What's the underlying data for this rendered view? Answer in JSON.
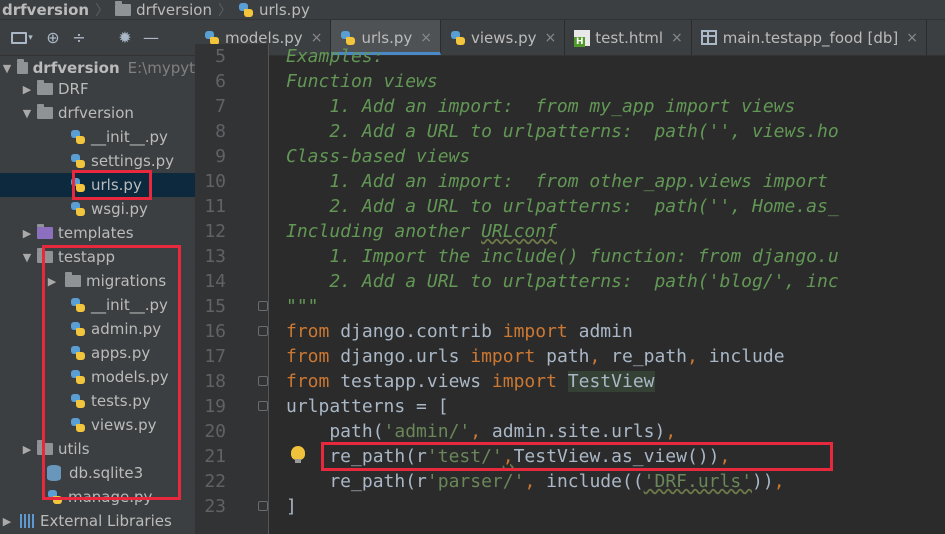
{
  "breadcrumb": [
    "drfversion",
    "drfversion",
    "urls.py"
  ],
  "tabs": [
    {
      "label": "models.py",
      "icon": "python-file-icon"
    },
    {
      "label": "urls.py",
      "icon": "python-file-icon",
      "active": true
    },
    {
      "label": "views.py",
      "icon": "python-file-icon"
    },
    {
      "label": "test.html",
      "icon": "html-file-icon"
    },
    {
      "label": "main.testapp_food [db]",
      "icon": "db-table-icon"
    }
  ],
  "tree": {
    "root_label": "drfversion",
    "root_path": "E:\\mypyt",
    "drf": "DRF",
    "drfversion": "drfversion",
    "init1": "__init__.py",
    "settings": "settings.py",
    "urls": "urls.py",
    "wsgi": "wsgi.py",
    "templates": "templates",
    "testapp": "testapp",
    "migrations": "migrations",
    "init2": "__init__.py",
    "admin": "admin.py",
    "apps": "apps.py",
    "models": "models.py",
    "tests": "tests.py",
    "views": "views.py",
    "utils": "utils",
    "db": "db.sqlite3",
    "manage": "manage.py",
    "libs": "External Libraries"
  },
  "line_numbers": [
    "5",
    "6",
    "7",
    "8",
    "9",
    "10",
    "11",
    "12",
    "13",
    "14",
    "15",
    "16",
    "17",
    "18",
    "19",
    "20",
    "21",
    "22",
    "23"
  ],
  "code": {
    "l5": "Examples:",
    "l6": "Function views",
    "l7": "    1. Add an import:  from my_app import views",
    "l8": "    2. Add a URL to urlpatterns:  path('', views.ho",
    "l9": "Class-based views",
    "l10": "    1. Add an import:  from other_app.views import",
    "l11": "    2. Add a URL to urlpatterns:  path('', Home.as_",
    "l12a": "Including another ",
    "l12b": "URLconf",
    "l13": "    1. Import the include() function: from django.u",
    "l14": "    2. Add a URL to urlpatterns:  path('blog/', inc",
    "l15": "\"\"\"",
    "l16_from": "from",
    "l16_mod": " django.contrib ",
    "l16_imp": "import",
    "l16_name": " admin",
    "l17_from": "from",
    "l17_mod": " django.urls ",
    "l17_imp": "import",
    "l17_a": " path",
    "l17_c1": ",",
    "l17_b": " re_path",
    "l17_c2": ",",
    "l17_c": " include",
    "l18_from": "from",
    "l18_mod": " testapp.views ",
    "l18_imp": "import",
    "l18_sp": " ",
    "l18_name": "TestView",
    "l19": "urlpatterns = [",
    "l20_a": "    path(",
    "l20_s": "'admin/'",
    "l20_c": ",",
    "l20_b": " admin.site.urls)",
    "l20_e": ",",
    "l21_a": "    re_path(r",
    "l21_s": "'test/'",
    "l21_c": ",",
    "l21_b": "TestView.as_view())",
    "l21_e": ",",
    "l22_a": "    re_path(r",
    "l22_s": "'parser/'",
    "l22_c": ",",
    "l22_b": " include((",
    "l22_s2": "'DRF.urls'",
    "l22_e": "))",
    "l22_f": ",",
    "l23": "]"
  },
  "colors": {
    "keyword": "#cc7832",
    "string": "#6a8759",
    "docstring": "#629755",
    "highlight_box": "#e8283c",
    "selection": "#0d293e"
  }
}
